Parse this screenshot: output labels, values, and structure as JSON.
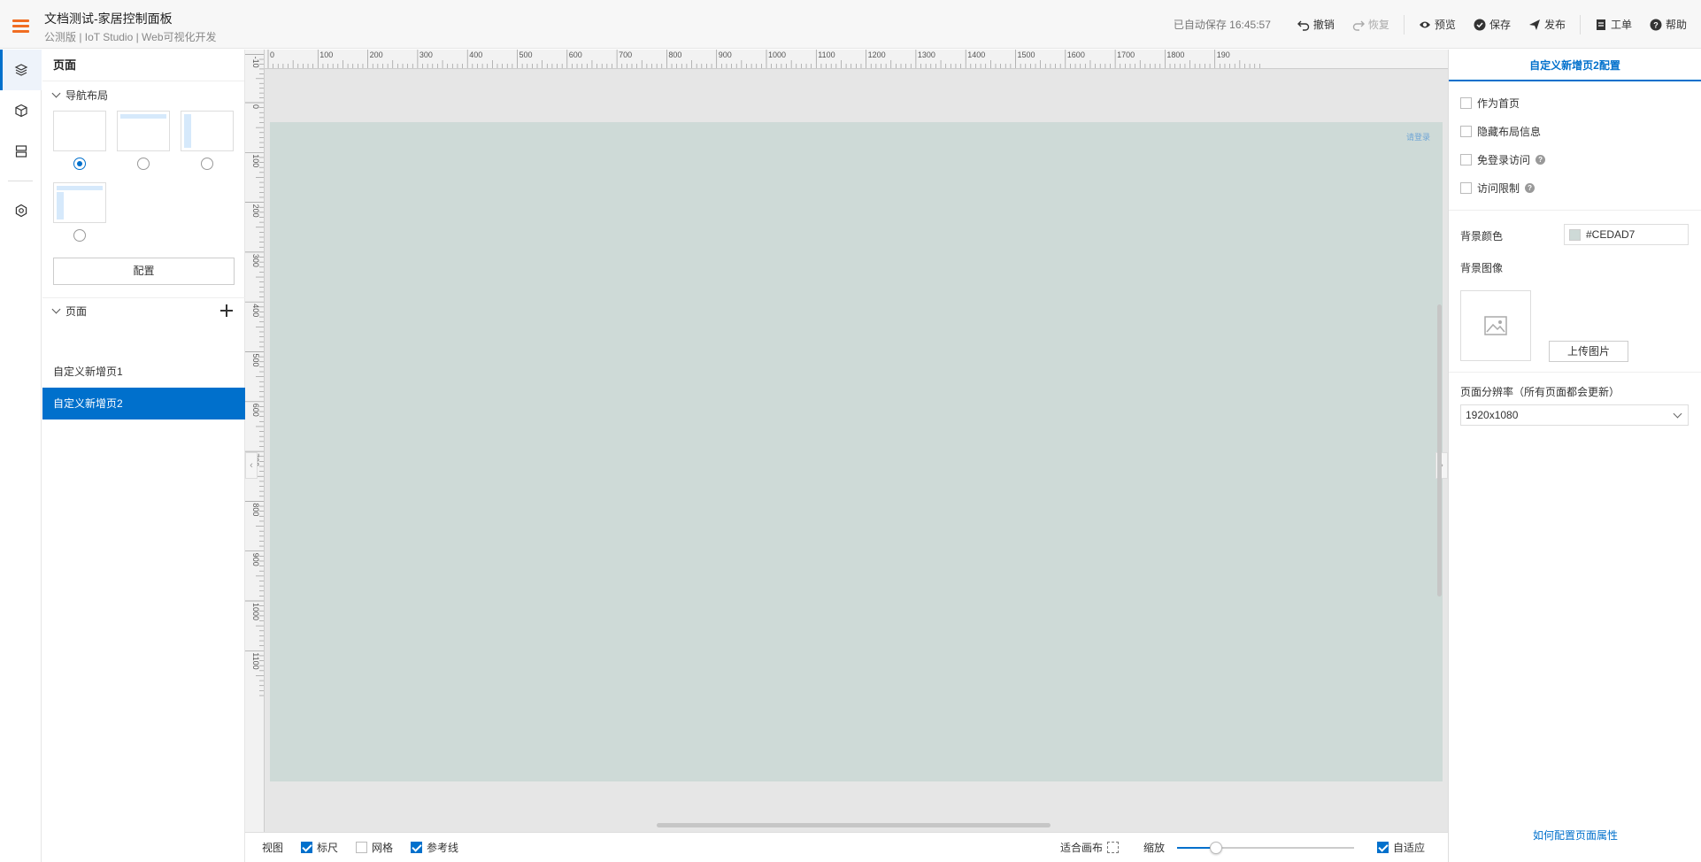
{
  "header": {
    "title": "文档测试-家居控制面板",
    "subtitle": "公测版 | IoT Studio | Web可视化开发",
    "autosave": "已自动保存 16:45:57",
    "undo": "撤销",
    "redo": "恢复",
    "preview": "预览",
    "save": "保存",
    "publish": "发布",
    "ticket": "工单",
    "help": "帮助"
  },
  "left_panel": {
    "title": "页面",
    "nav_layout_label": "导航布局",
    "config_button": "配置",
    "pages_label": "页面",
    "pages": [
      "自定义新增页1",
      "自定义新增页2"
    ],
    "selected_layout": 0
  },
  "canvas": {
    "login_text": "请登录",
    "background": "#CEDAD7",
    "ruler_h": [
      "0",
      "100",
      "200",
      "300",
      "400",
      "500",
      "600",
      "700",
      "800",
      "900",
      "1000",
      "1100",
      "1200",
      "1300",
      "1400",
      "1500",
      "1600",
      "1700",
      "1800",
      "190"
    ],
    "ruler_v": [
      "-10",
      "0",
      "100",
      "200",
      "300",
      "400",
      "500",
      "600",
      "700",
      "800",
      "900",
      "1000",
      "1100"
    ]
  },
  "bottom_bar": {
    "view": "视图",
    "ruler": "标尺",
    "ruler_checked": true,
    "grid": "网格",
    "grid_checked": false,
    "guides": "参考线",
    "guides_checked": true,
    "fit_canvas": "适合画布",
    "zoom": "缩放",
    "zoom_level": 0.22,
    "auto_fit": "自适应",
    "auto_fit_checked": true
  },
  "right_panel": {
    "tab": "自定义新增页2配置",
    "as_home": "作为首页",
    "hide_layout": "隐藏布局信息",
    "no_login": "免登录访问",
    "access_limit": "访问限制",
    "bg_color_label": "背景颜色",
    "bg_color_value": "#CEDAD7",
    "bg_image_label": "背景图像",
    "upload": "上传图片",
    "resolution_label": "页面分辨率（所有页面都会更新）",
    "resolution_value": "1920x1080",
    "help_link": "如何配置页面属性"
  },
  "colors": {
    "accent": "#0070cc",
    "brand_orange": "#f06d22"
  }
}
